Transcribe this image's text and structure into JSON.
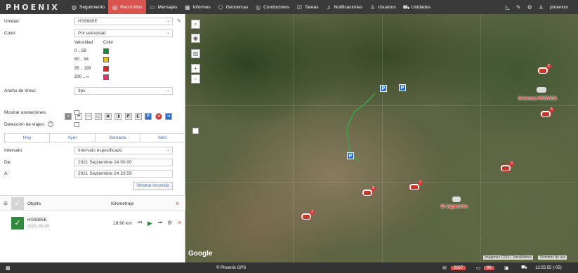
{
  "app": {
    "logo": "PHOENIX"
  },
  "nav": [
    {
      "label": "Seguimiento",
      "icon": "globe-icon"
    },
    {
      "label": "Recorridos",
      "icon": "route-icon",
      "active": true
    },
    {
      "label": "Mensajes",
      "icon": "message-icon"
    },
    {
      "label": "Informes",
      "icon": "report-icon"
    },
    {
      "label": "Geocercas",
      "icon": "geofence-icon"
    },
    {
      "label": "Conductores",
      "icon": "driver-icon"
    },
    {
      "label": "Tareas",
      "icon": "task-icon"
    },
    {
      "label": "Notificaciones",
      "icon": "bell-icon"
    },
    {
      "label": "Usuarios",
      "icon": "user-icon"
    },
    {
      "label": "Unidades",
      "icon": "car-icon"
    }
  ],
  "topright": {
    "username": "phoenixx"
  },
  "form": {
    "unidad_label": "Unidad:",
    "unidad_value": "HS9985E",
    "color_label": "Color:",
    "color_value": "Por velocidad",
    "velocidad_header": "Velocidad",
    "color_header": "Color",
    "speed_ranges": [
      {
        "range": "0 .. 59",
        "color": "#1e8a3a"
      },
      {
        "range": "60 .. 94",
        "color": "#e8c21a"
      },
      {
        "range": "95 .. 199",
        "color": "#e2231a"
      },
      {
        "range": "200 .. ∞",
        "color": "#e8316c"
      }
    ],
    "ancho_label": "Ancho de línea:",
    "ancho_value": "3px",
    "anotaciones_label": "Mostrar anotaciones:",
    "viajes_label": "Detección de viajes:",
    "tabs": [
      "Hoy",
      "Ayer",
      "Semana",
      "Mes"
    ],
    "intervalo_label": "Intervalo:",
    "intervalo_value": "Intervalo especificado",
    "de_label": "De:",
    "de_value": "2021 Septiembre 24 00:00",
    "a_label": "A:",
    "a_value": "2021 Septiembre 24 23:59",
    "show_button": "Mostrar recorrido"
  },
  "objects": {
    "header_objeto": "Objeto",
    "header_km": "Kilometraje",
    "rows": [
      {
        "name": "HS9985E",
        "date": "2021-09-24",
        "km": "18.90 km"
      }
    ]
  },
  "map": {
    "labels": [
      "Sistemas PROVISA",
      "El Jaguarcito"
    ],
    "badges": [
      "2",
      "5",
      "3",
      "2",
      "9",
      "3"
    ],
    "attribution": "Imágenes ©2021 TerraMetrics",
    "terms": "Términos de uso",
    "google": "Google"
  },
  "bottom": {
    "center": "© Phoenix GPS",
    "counter1": "2057",
    "counter2": "96",
    "time": "12:55:55 (-05)"
  }
}
